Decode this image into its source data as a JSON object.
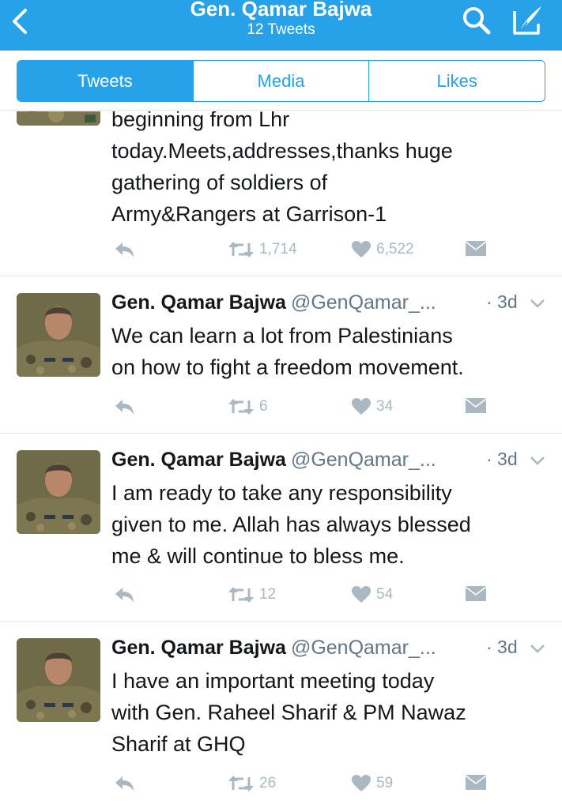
{
  "header": {
    "title": "Gen. Qamar Bajwa",
    "subtitle": "12 Tweets",
    "back_icon": "chevron-left-icon",
    "search_icon": "search-icon",
    "compose_icon": "compose-icon",
    "color": "#27a2e8"
  },
  "tabs": [
    {
      "label": "Tweets",
      "active": true
    },
    {
      "label": "Media",
      "active": false
    },
    {
      "label": "Likes",
      "active": false
    }
  ],
  "tweets": [
    {
      "lines": [
        "beginning from Lhr",
        "today.Meets,addresses,thanks huge",
        "gathering of soldiers of",
        "Army&Rangers at Garrison-1"
      ],
      "retweets": "1,714",
      "likes": "6,522"
    },
    {
      "author": "Gen. Qamar Bajwa",
      "handle": "@GenQamar_...",
      "time": "· 3d",
      "lines": [
        "We can learn a lot from Palestinians",
        "on how to fight a freedom movement."
      ],
      "retweets": "6",
      "likes": "34"
    },
    {
      "author": "Gen. Qamar Bajwa",
      "handle": "@GenQamar_...",
      "time": "· 3d",
      "lines": [
        "I am ready to take any responsibility",
        "given to me. Allah has always blessed",
        "me & will continue to bless me."
      ],
      "retweets": "12",
      "likes": "54"
    },
    {
      "author": "Gen. Qamar Bajwa",
      "handle": "@GenQamar_...",
      "time": "· 3d",
      "lines": [
        "I have an important meeting today",
        "with Gen. Raheel Sharif & PM Nawaz",
        "Sharif at GHQ"
      ],
      "retweets": "26",
      "likes": "59"
    }
  ],
  "icons": {
    "reply": "reply-icon",
    "retweet": "retweet-icon",
    "like": "heart-icon",
    "dm": "envelope-icon"
  }
}
